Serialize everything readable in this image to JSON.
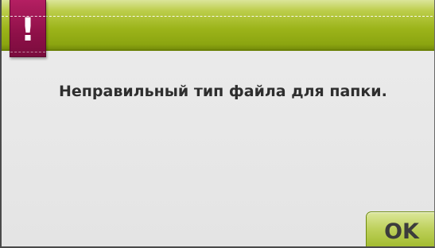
{
  "dialog": {
    "warning_glyph": "!",
    "warning_icon": "exclamation-icon",
    "message": "Неправильный тип файла для папки.",
    "ok_label": "OK"
  },
  "colors": {
    "header_green": "#9cb41a",
    "warning_tab_magenta": "#8e1048",
    "button_green": "#bdd05a",
    "background": "#e8e8e8",
    "text": "#2e2e2e"
  }
}
